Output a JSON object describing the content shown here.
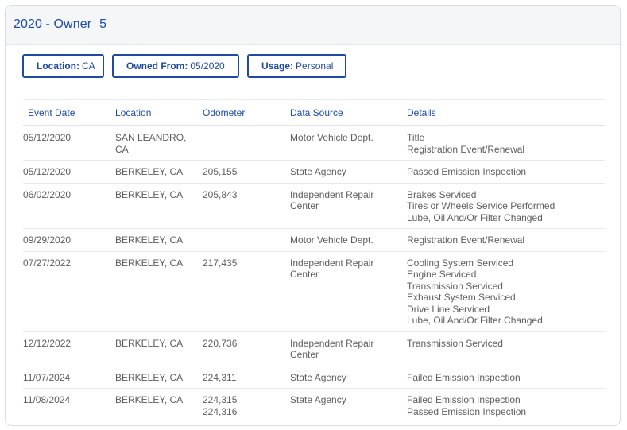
{
  "header": {
    "title": "2020 - Owner",
    "owner_number": "5"
  },
  "chips": [
    {
      "label": "Location:",
      "value": "CA"
    },
    {
      "label": "Owned From:",
      "value": "05/2020"
    },
    {
      "label": "Usage:",
      "value": "Personal"
    }
  ],
  "table": {
    "columns": [
      "Event Date",
      "Location",
      "Odometer",
      "Data Source",
      "Details"
    ],
    "rows": [
      {
        "date": "05/12/2020",
        "location": [
          "SAN LEANDRO,",
          "CA"
        ],
        "odometer": [],
        "source": [
          "Motor Vehicle Dept."
        ],
        "details": [
          "Title",
          "Registration Event/Renewal"
        ]
      },
      {
        "date": "05/12/2020",
        "location": [
          "BERKELEY, CA"
        ],
        "odometer": [
          "205,155"
        ],
        "source": [
          "State Agency"
        ],
        "details": [
          "Passed Emission Inspection"
        ]
      },
      {
        "date": "06/02/2020",
        "location": [
          "BERKELEY, CA"
        ],
        "odometer": [
          "205,843"
        ],
        "source": [
          "Independent Repair",
          "Center"
        ],
        "details": [
          "Brakes Serviced",
          "Tires or Wheels Service Performed",
          "Lube, Oil And/Or Filter Changed"
        ]
      },
      {
        "date": "09/29/2020",
        "location": [
          "BERKELEY, CA"
        ],
        "odometer": [],
        "source": [
          "Motor Vehicle Dept."
        ],
        "details": [
          "Registration Event/Renewal"
        ]
      },
      {
        "date": "07/27/2022",
        "location": [
          "BERKELEY, CA"
        ],
        "odometer": [
          "217,435"
        ],
        "source": [
          "Independent Repair",
          "Center"
        ],
        "details": [
          "Cooling System Serviced",
          "Engine Serviced",
          "Transmission Serviced",
          "Exhaust System Serviced",
          "Drive Line Serviced",
          "Lube, Oil And/Or Filter Changed"
        ]
      },
      {
        "date": "12/12/2022",
        "location": [
          "BERKELEY, CA"
        ],
        "odometer": [
          "220,736"
        ],
        "source": [
          "Independent Repair",
          "Center"
        ],
        "details": [
          "Transmission Serviced"
        ]
      },
      {
        "date": "11/07/2024",
        "location": [
          "BERKELEY, CA"
        ],
        "odometer": [
          "224,311"
        ],
        "source": [
          "State Agency"
        ],
        "details": [
          "Failed Emission Inspection"
        ]
      },
      {
        "date": "11/08/2024",
        "location": [
          "BERKELEY, CA"
        ],
        "odometer": [
          "224,315",
          "224,316"
        ],
        "source": [
          "State Agency"
        ],
        "details": [
          "Failed Emission Inspection",
          "Passed Emission Inspection"
        ]
      }
    ]
  }
}
